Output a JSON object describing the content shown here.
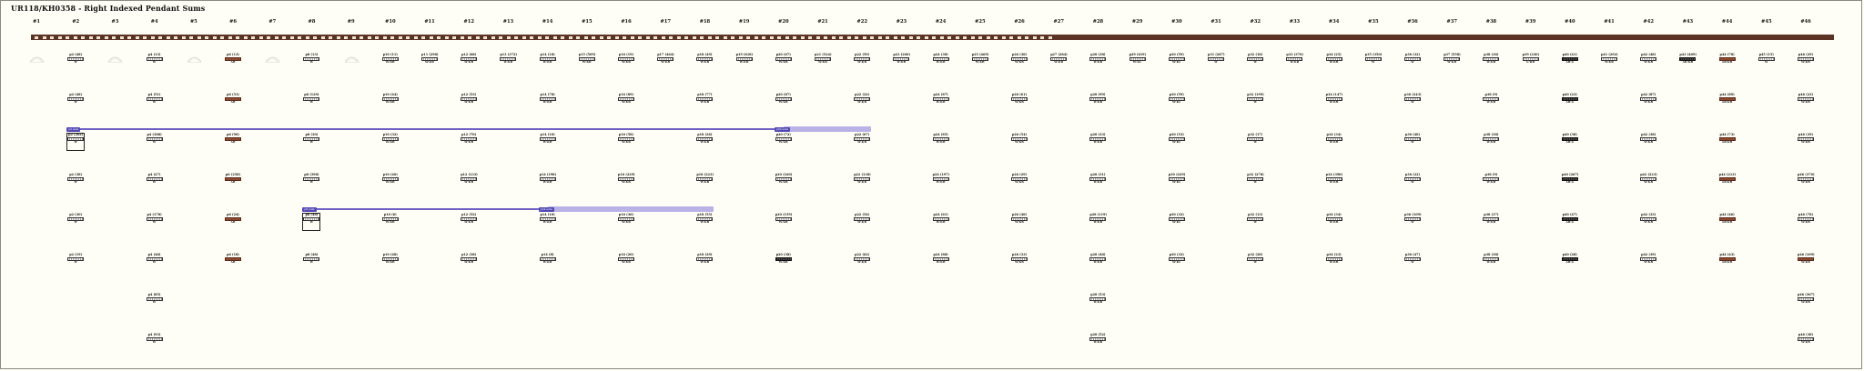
{
  "title": "UR118/KH0358 - Right Indexed Pendant Sums",
  "columns": [
    "#1",
    "#2",
    "#3",
    "#4",
    "#5",
    "#6",
    "#7",
    "#8",
    "#9",
    "#10",
    "#11",
    "#12",
    "#13",
    "#14",
    "#15",
    "#16",
    "#17",
    "#18",
    "#19",
    "#20",
    "#21",
    "#22",
    "#23",
    "#24",
    "#25",
    "#26",
    "#27",
    "#28",
    "#29",
    "#30",
    "#31",
    "#32",
    "#33",
    "#34",
    "#35",
    "#36",
    "#37",
    "#38",
    "#39",
    "#40",
    "#41",
    "#42",
    "#43",
    "#44",
    "#45",
    "#46"
  ],
  "colors": {
    "background": "#fffef6",
    "band": "#5b3324",
    "link": "#6d5fc4",
    "link_fill": "#b9b2e6",
    "brown_knot": "#8a4a32"
  },
  "ghost_columns": [
    1,
    3,
    5,
    7,
    9
  ],
  "cells": [
    {
      "col": 2,
      "row": 0,
      "label": "p2 (48)",
      "color": "W"
    },
    {
      "col": 2,
      "row": 1,
      "label": "p2 (48)",
      "color": "W"
    },
    {
      "col": 2,
      "row": 2,
      "label": "p2 (202)",
      "color": "W"
    },
    {
      "col": 2,
      "row": 3,
      "label": "p2 (38)",
      "color": "W"
    },
    {
      "col": 2,
      "row": 4,
      "label": "p2 (30)",
      "color": "W"
    },
    {
      "col": 2,
      "row": 5,
      "label": "p2 (19)",
      "color": "W"
    },
    {
      "col": 4,
      "row": 0,
      "label": "p4 (13)",
      "color": "W"
    },
    {
      "col": 4,
      "row": 1,
      "label": "p4 (51)",
      "color": "W"
    },
    {
      "col": 4,
      "row": 2,
      "label": "p4 (388)",
      "color": "W"
    },
    {
      "col": 4,
      "row": 3,
      "label": "p4 (27)",
      "color": "W"
    },
    {
      "col": 4,
      "row": 4,
      "label": "p4 (178)",
      "color": "W"
    },
    {
      "col": 4,
      "row": 5,
      "label": "p4 (48)",
      "color": "W"
    },
    {
      "col": 4,
      "row": 6,
      "label": "p4 (85)",
      "color": "W"
    },
    {
      "col": 4,
      "row": 7,
      "label": "p4 (93)",
      "color": "W"
    },
    {
      "col": 6,
      "row": 0,
      "label": "p6 (13)",
      "color": "AB",
      "brown": true
    },
    {
      "col": 6,
      "row": 1,
      "label": "p6 (51)",
      "color": "AB",
      "brown": true
    },
    {
      "col": 6,
      "row": 2,
      "label": "p6 (90)",
      "color": "AB",
      "brown": true
    },
    {
      "col": 6,
      "row": 3,
      "label": "p6 (258)",
      "color": "AB",
      "brown": true
    },
    {
      "col": 6,
      "row": 4,
      "label": "p6 (24)",
      "color": "AB",
      "brown": true
    },
    {
      "col": 6,
      "row": 5,
      "label": "p6 (18)",
      "color": "AB",
      "brown": true
    },
    {
      "col": 8,
      "row": 0,
      "label": "p8 (13)",
      "color": "W"
    },
    {
      "col": 8,
      "row": 1,
      "label": "p8 (129)",
      "color": "W"
    },
    {
      "col": 8,
      "row": 2,
      "label": "p8 (30)",
      "color": "W"
    },
    {
      "col": 8,
      "row": 3,
      "label": "p8 (398)",
      "color": "W"
    },
    {
      "col": 8,
      "row": 4,
      "label": "p8 (48)",
      "color": "W"
    },
    {
      "col": 8,
      "row": 5,
      "label": "p8 (48)",
      "color": "W"
    },
    {
      "col": 10,
      "row": 0,
      "label": "p10 (11)",
      "color": "W:KB"
    },
    {
      "col": 10,
      "row": 1,
      "label": "p10 (44)",
      "color": "W:KB"
    },
    {
      "col": 10,
      "row": 2,
      "label": "p10 (32)",
      "color": "W:KB"
    },
    {
      "col": 10,
      "row": 3,
      "label": "p10 (40)",
      "color": "W:KB"
    },
    {
      "col": 10,
      "row": 4,
      "label": "p10 (6)",
      "color": "W:KB"
    },
    {
      "col": 10,
      "row": 5,
      "label": "p10 (48)",
      "color": "W:KB"
    },
    {
      "col": 11,
      "row": 0,
      "label": "p11 (298)",
      "color": "W:KB"
    },
    {
      "col": 12,
      "row": 0,
      "label": "p12 (68)",
      "color": "W:KB"
    },
    {
      "col": 12,
      "row": 1,
      "label": "p12 (53)",
      "color": "W:KB"
    },
    {
      "col": 12,
      "row": 2,
      "label": "p12 (70)",
      "color": "W:KB"
    },
    {
      "col": 12,
      "row": 3,
      "label": "p12 (133)",
      "color": "W:KB"
    },
    {
      "col": 12,
      "row": 4,
      "label": "p12 (52)",
      "color": "W:KB"
    },
    {
      "col": 12,
      "row": 5,
      "label": "p12 (38)",
      "color": "W:KB"
    },
    {
      "col": 13,
      "row": 0,
      "label": "p13 (372)",
      "color": "W:KB"
    },
    {
      "col": 14,
      "row": 0,
      "label": "p14 (18)",
      "color": "W:KB"
    },
    {
      "col": 14,
      "row": 1,
      "label": "p14 (78)",
      "color": "W:KB"
    },
    {
      "col": 14,
      "row": 2,
      "label": "p14 (10)",
      "color": "W:KB"
    },
    {
      "col": 14,
      "row": 3,
      "label": "p14 (198)",
      "color": "W:KB"
    },
    {
      "col": 14,
      "row": 4,
      "label": "p14 (10)",
      "color": "W:KB"
    },
    {
      "col": 14,
      "row": 5,
      "label": "p14 (8)",
      "color": "W:KB"
    },
    {
      "col": 15,
      "row": 0,
      "label": "p15 (509)",
      "color": "W:KB"
    },
    {
      "col": 16,
      "row": 0,
      "label": "p16 (19)",
      "color": "W:KB"
    },
    {
      "col": 16,
      "row": 1,
      "label": "p16 (89)",
      "color": "W:KB"
    },
    {
      "col": 16,
      "row": 2,
      "label": "p16 (58)",
      "color": "W:KB"
    },
    {
      "col": 16,
      "row": 3,
      "label": "p16 (229)",
      "color": "W:KB"
    },
    {
      "col": 16,
      "row": 4,
      "label": "p16 (36)",
      "color": "W:KB"
    },
    {
      "col": 16,
      "row": 5,
      "label": "p16 (20)",
      "color": "W:KB"
    },
    {
      "col": 17,
      "row": 0,
      "label": "p17 (464)",
      "color": "W:KB"
    },
    {
      "col": 18,
      "row": 0,
      "label": "p18 (49)",
      "color": "W:KB"
    },
    {
      "col": 18,
      "row": 1,
      "label": "p18 (77)",
      "color": "W:KB"
    },
    {
      "col": 18,
      "row": 2,
      "label": "p18 (26)",
      "color": "W:KB"
    },
    {
      "col": 18,
      "row": 3,
      "label": "p18 (223)",
      "color": "W:KB"
    },
    {
      "col": 18,
      "row": 4,
      "label": "p18 (55)",
      "color": "W:KB"
    },
    {
      "col": 18,
      "row": 5,
      "label": "p18 (29)",
      "color": "W:KB"
    },
    {
      "col": 19,
      "row": 0,
      "label": "p19 (618)",
      "color": "W:KB"
    },
    {
      "col": 20,
      "row": 0,
      "label": "p20 (67)",
      "color": "W:KB"
    },
    {
      "col": 20,
      "row": 1,
      "label": "p20 (87)",
      "color": "W:KB"
    },
    {
      "col": 20,
      "row": 2,
      "label": "p20 (72)",
      "color": "W:KB"
    },
    {
      "col": 20,
      "row": 3,
      "label": "p20 (160)",
      "color": "W:KB"
    },
    {
      "col": 20,
      "row": 4,
      "label": "p20 (159)",
      "color": "W:KB"
    },
    {
      "col": 20,
      "row": 5,
      "label": "p20 (38)",
      "color": "W:KB",
      "dark": true
    },
    {
      "col": 21,
      "row": 0,
      "label": "p21 (524)",
      "color": "W:KB"
    },
    {
      "col": 22,
      "row": 0,
      "label": "p22 (59)",
      "color": "W:KB"
    },
    {
      "col": 22,
      "row": 1,
      "label": "p22 (22)",
      "color": "W:KB"
    },
    {
      "col": 22,
      "row": 2,
      "label": "p22 (67)",
      "color": "W:KB"
    },
    {
      "col": 22,
      "row": 3,
      "label": "p22 (138)",
      "color": "W:KB"
    },
    {
      "col": 22,
      "row": 4,
      "label": "p22 (54)",
      "color": "W:KB"
    },
    {
      "col": 22,
      "row": 5,
      "label": "p22 (62)",
      "color": "W:KB"
    },
    {
      "col": 23,
      "row": 0,
      "label": "p23 (200)",
      "color": "W:KB"
    },
    {
      "col": 24,
      "row": 0,
      "label": "p24 (38)",
      "color": "W:KB"
    },
    {
      "col": 24,
      "row": 1,
      "label": "p24 (87)",
      "color": "W:KB"
    },
    {
      "col": 24,
      "row": 2,
      "label": "p24 (85)",
      "color": "W:KB"
    },
    {
      "col": 24,
      "row": 3,
      "label": "p24 (197)",
      "color": "W:KB"
    },
    {
      "col": 24,
      "row": 4,
      "label": "p24 (61)",
      "color": "W:KB"
    },
    {
      "col": 24,
      "row": 5,
      "label": "p24 (88)",
      "color": "W:KB"
    },
    {
      "col": 25,
      "row": 0,
      "label": "p25 (469)",
      "color": "W:KB"
    },
    {
      "col": 26,
      "row": 0,
      "label": "p26 (38)",
      "color": "W:KB"
    },
    {
      "col": 26,
      "row": 1,
      "label": "p26 (61)",
      "color": "W:KB"
    },
    {
      "col": 26,
      "row": 2,
      "label": "p26 (54)",
      "color": "W:KB"
    },
    {
      "col": 26,
      "row": 3,
      "label": "p26 (29)",
      "color": "W:KB"
    },
    {
      "col": 26,
      "row": 4,
      "label": "p26 (48)",
      "color": "W:KB"
    },
    {
      "col": 26,
      "row": 5,
      "label": "p26 (33)",
      "color": "W:KB"
    },
    {
      "col": 27,
      "row": 0,
      "label": "p27 (284)",
      "color": "W:KB"
    },
    {
      "col": 28,
      "row": 0,
      "label": "p28 (38)",
      "color": "W:KB"
    },
    {
      "col": 28,
      "row": 1,
      "label": "p28 (99)",
      "color": "W:KB"
    },
    {
      "col": 28,
      "row": 2,
      "label": "p28 (33)",
      "color": "W:KB"
    },
    {
      "col": 28,
      "row": 3,
      "label": "p28 (31)",
      "color": "W:KB"
    },
    {
      "col": 28,
      "row": 4,
      "label": "p28 (119)",
      "color": "W:KB"
    },
    {
      "col": 28,
      "row": 5,
      "label": "p28 (48)",
      "color": "W:KB"
    },
    {
      "col": 28,
      "row": 6,
      "label": "p28 (53)",
      "color": "W:KB"
    },
    {
      "col": 28,
      "row": 7,
      "label": "p28 (52)",
      "color": "W:KB"
    },
    {
      "col": 29,
      "row": 0,
      "label": "p29 (619)",
      "color": "W:KL"
    },
    {
      "col": 30,
      "row": 0,
      "label": "p30 (59)",
      "color": "W:KL"
    },
    {
      "col": 30,
      "row": 1,
      "label": "p30 (59)",
      "color": "W:KL"
    },
    {
      "col": 30,
      "row": 2,
      "label": "p30 (53)",
      "color": "W:KL"
    },
    {
      "col": 30,
      "row": 3,
      "label": "p30 (229)",
      "color": "W:KL"
    },
    {
      "col": 30,
      "row": 4,
      "label": "p30 (32)",
      "color": "W:KL"
    },
    {
      "col": 30,
      "row": 5,
      "label": "p30 (32)",
      "color": "W:KL"
    },
    {
      "col": 31,
      "row": 0,
      "label": "p31 (287)",
      "color": "W"
    },
    {
      "col": 32,
      "row": 0,
      "label": "p32 (18)",
      "color": "W"
    },
    {
      "col": 32,
      "row": 1,
      "label": "p32 (199)",
      "color": "W"
    },
    {
      "col": 32,
      "row": 2,
      "label": "p32 (17)",
      "color": "W"
    },
    {
      "col": 32,
      "row": 3,
      "label": "p32 (278)",
      "color": "W"
    },
    {
      "col": 32,
      "row": 4,
      "label": "p32 (13)",
      "color": "W"
    },
    {
      "col": 32,
      "row": 5,
      "label": "p32 (28)",
      "color": "W"
    },
    {
      "col": 33,
      "row": 0,
      "label": "p33 (370)",
      "color": "W:KB"
    },
    {
      "col": 34,
      "row": 0,
      "label": "p34 (25)",
      "color": "W:KB"
    },
    {
      "col": 34,
      "row": 1,
      "label": "p34 (147)",
      "color": "W:KB"
    },
    {
      "col": 34,
      "row": 2,
      "label": "p34 (34)",
      "color": "W:KB"
    },
    {
      "col": 34,
      "row": 3,
      "label": "p34 (398)",
      "color": "W:KB"
    },
    {
      "col": 34,
      "row": 4,
      "label": "p34 (34)",
      "color": "W:KB"
    },
    {
      "col": 34,
      "row": 5,
      "label": "p34 (23)",
      "color": "W:KB"
    },
    {
      "col": 35,
      "row": 0,
      "label": "p35 (350)",
      "color": "W"
    },
    {
      "col": 36,
      "row": 0,
      "label": "p36 (32)",
      "color": "W"
    },
    {
      "col": 36,
      "row": 1,
      "label": "p36 (243)",
      "color": "W"
    },
    {
      "col": 36,
      "row": 2,
      "label": "p36 (48)",
      "color": "W"
    },
    {
      "col": 36,
      "row": 3,
      "label": "p36 (22)",
      "color": "W"
    },
    {
      "col": 36,
      "row": 4,
      "label": "p36 (109)",
      "color": "W"
    },
    {
      "col": 36,
      "row": 5,
      "label": "p36 (47)",
      "color": "W"
    },
    {
      "col": 37,
      "row": 0,
      "label": "p37 (558)",
      "color": "W:KB"
    },
    {
      "col": 38,
      "row": 0,
      "label": "p38 (36)",
      "color": "W:KB"
    },
    {
      "col": 38,
      "row": 1,
      "label": "p38 (9)",
      "color": "W:KB"
    },
    {
      "col": 38,
      "row": 2,
      "label": "p38 (38)",
      "color": "W:KB"
    },
    {
      "col": 38,
      "row": 3,
      "label": "p38 (9)",
      "color": "W:KB"
    },
    {
      "col": 38,
      "row": 4,
      "label": "p38 (37)",
      "color": "W:KB"
    },
    {
      "col": 38,
      "row": 5,
      "label": "p38 (38)",
      "color": "W:KB"
    },
    {
      "col": 39,
      "row": 0,
      "label": "p39 (230)",
      "color": "G:RB"
    },
    {
      "col": 40,
      "row": 0,
      "label": "p40 (41)",
      "color": "AB:G",
      "dark": true
    },
    {
      "col": 40,
      "row": 1,
      "label": "p40 (23)",
      "color": "AB:G",
      "dark": true
    },
    {
      "col": 40,
      "row": 2,
      "label": "p40 (38)",
      "color": "AB:G",
      "dark": true
    },
    {
      "col": 40,
      "row": 3,
      "label": "p40 (267)",
      "color": "AB:G",
      "dark": true
    },
    {
      "col": 40,
      "row": 4,
      "label": "p40 (47)",
      "color": "AB:G",
      "dark": true
    },
    {
      "col": 40,
      "row": 5,
      "label": "p40 (28)",
      "color": "AB:G",
      "dark": true
    },
    {
      "col": 41,
      "row": 0,
      "label": "p41 (292)",
      "color": "W:KB"
    },
    {
      "col": 42,
      "row": 0,
      "label": "p42 (48)",
      "color": "W:KB"
    },
    {
      "col": 42,
      "row": 1,
      "label": "p42 (87)",
      "color": "W:KB"
    },
    {
      "col": 42,
      "row": 2,
      "label": "p42 (38)",
      "color": "W:KB"
    },
    {
      "col": 42,
      "row": 3,
      "label": "p42 (223)",
      "color": "W:KB"
    },
    {
      "col": 42,
      "row": 4,
      "label": "p42 (33)",
      "color": "W:KB"
    },
    {
      "col": 42,
      "row": 5,
      "label": "p42 (39)",
      "color": "W:KB"
    },
    {
      "col": 43,
      "row": 0,
      "label": "p43 (409)",
      "color": "AB:KB",
      "dark": true
    },
    {
      "col": 44,
      "row": 0,
      "label": "p44 (78)",
      "color": "AB:KB",
      "brown": true
    },
    {
      "col": 44,
      "row": 1,
      "label": "p44 (89)",
      "color": "AB:KB",
      "brown": true
    },
    {
      "col": 44,
      "row": 2,
      "label": "p44 (73)",
      "color": "AB:KB",
      "brown": true
    },
    {
      "col": 44,
      "row": 3,
      "label": "p44 (213)",
      "color": "AB:KB",
      "brown": true
    },
    {
      "col": 44,
      "row": 4,
      "label": "p44 (46)",
      "color": "AB:KB",
      "brown": true
    },
    {
      "col": 44,
      "row": 5,
      "label": "p44 (43)",
      "color": "AB:KB",
      "brown": true
    },
    {
      "col": 45,
      "row": 0,
      "label": "p45 (15)",
      "color": "W"
    },
    {
      "col": 46,
      "row": 0,
      "label": "p46 (29)",
      "color": "W:KB"
    },
    {
      "col": 46,
      "row": 1,
      "label": "p46 (23)",
      "color": "W:KB"
    },
    {
      "col": 46,
      "row": 2,
      "label": "p46 (39)",
      "color": "W:KB"
    },
    {
      "col": 46,
      "row": 3,
      "label": "p46 (370)",
      "color": "W:KB"
    },
    {
      "col": 46,
      "row": 4,
      "label": "p46 (78)",
      "color": "W:KB"
    },
    {
      "col": 46,
      "row": 5,
      "label": "p46 (109)",
      "color": "W:KB",
      "brown": true
    },
    {
      "col": 46,
      "row": 6,
      "label": "p46 (367)",
      "color": "W:KB"
    },
    {
      "col": 46,
      "row": 7,
      "label": "p46 (38)",
      "color": "W:KB"
    }
  ],
  "links": [
    {
      "from_col": 2,
      "to_col": 20,
      "row": 2,
      "tag_start": "p2 sum",
      "tag_end": "p20 sum",
      "fill_from_col": 20,
      "fill_to_col": 22
    },
    {
      "from_col": 8,
      "to_col": 14,
      "row": 4,
      "tag_start": "p8 sum",
      "tag_end": "p14 sum",
      "fill_from_col": 14,
      "fill_to_col": 18
    }
  ],
  "boxed_cells": [
    {
      "col": 2,
      "row": 2
    },
    {
      "col": 8,
      "row": 4
    }
  ]
}
